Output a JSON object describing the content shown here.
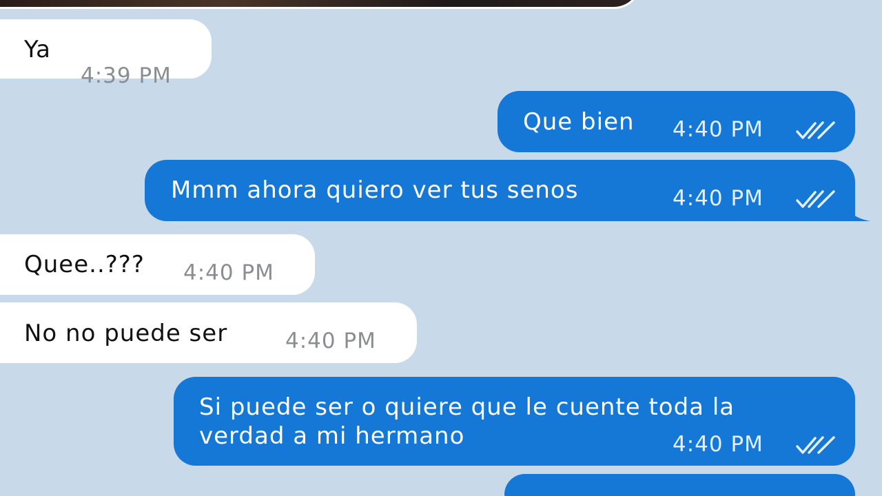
{
  "messages": [
    {
      "direction": "in",
      "text": "Ya",
      "time": "4:39 PM"
    },
    {
      "direction": "out",
      "text": "Que bien",
      "time": "4:40 PM",
      "status": "read-double-check-icon"
    },
    {
      "direction": "out",
      "text": "Mmm ahora quiero ver tus senos",
      "time": "4:40 PM",
      "status": "read-double-check-icon"
    },
    {
      "direction": "in",
      "text": "Quee..???",
      "time": "4:40 PM"
    },
    {
      "direction": "in",
      "text": "No no puede ser",
      "time": "4:40 PM"
    },
    {
      "direction": "out",
      "text_line1": "Si puede ser o quiere que le cuente toda la",
      "text_line2": "verdad a mi hermano",
      "time": "4:40 PM",
      "status": "read-double-check-icon"
    }
  ],
  "colors": {
    "background": "#c8d9ea",
    "incoming_bubble": "#ffffff",
    "outgoing_bubble": "#1577d6",
    "incoming_time": "#8a8e93",
    "outgoing_time": "#e4efff"
  }
}
